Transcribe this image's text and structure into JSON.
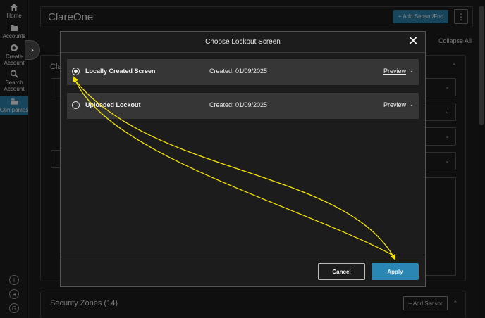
{
  "nav": {
    "items": [
      {
        "label": "Home",
        "icon": "home-icon"
      },
      {
        "label": "Accounts",
        "icon": "folder-icon"
      },
      {
        "label": "Create Account",
        "icon": "plus-circle-icon"
      },
      {
        "label": "Search Account",
        "icon": "search-icon"
      },
      {
        "label": "Companies",
        "icon": "companies-icon"
      }
    ],
    "bottom_icons": [
      {
        "icon": "info-icon",
        "glyph": "i"
      },
      {
        "icon": "sound-icon",
        "glyph": "◂"
      },
      {
        "icon": "copyright-icon",
        "glyph": "G"
      }
    ]
  },
  "header": {
    "title": "ClareOne",
    "add_sensor_fob": "+ Add Sensor/Fob",
    "menu_glyph": "⋮"
  },
  "background": {
    "collapse_all": "Collapse All",
    "card_title": "Cla",
    "security_zones_title": "Security Zones (14)",
    "add_sensor": "+ Add Sensor"
  },
  "modal": {
    "title": "Choose Lockout Screen",
    "close_glyph": "✕",
    "options": [
      {
        "name": "Locally Created Screen",
        "created": "Created: 01/09/2025",
        "preview": "Preview",
        "selected": true
      },
      {
        "name": "Uploaded Lockout",
        "created": "Created: 01/09/2025",
        "preview": "Preview",
        "selected": false
      }
    ],
    "cancel": "Cancel",
    "apply": "Apply"
  },
  "colors": {
    "accent": "#2a86b2",
    "annotation": "#f5e400",
    "modal_bg": "#1c1c1c",
    "row_bg": "#363636"
  }
}
